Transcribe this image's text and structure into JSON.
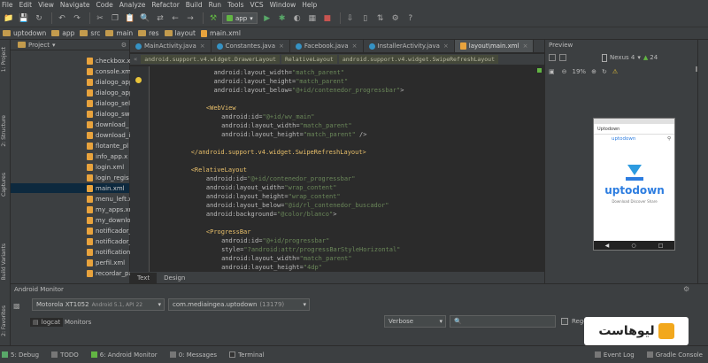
{
  "menu": [
    "File",
    "Edit",
    "View",
    "Navigate",
    "Code",
    "Analyze",
    "Refactor",
    "Build",
    "Run",
    "Tools",
    "VCS",
    "Window",
    "Help"
  ],
  "toolbar": {
    "run_config": "app"
  },
  "nav": [
    "uptodown",
    "app",
    "src",
    "main",
    "res",
    "layout",
    "main.xml"
  ],
  "left_tools": [
    "1: Project",
    "2: Structure",
    "Captures",
    "Build Variants",
    "2: Favorites"
  ],
  "project": {
    "header": "Project",
    "files": [
      "checkbox.xr",
      "console.xml",
      "dialogo_app",
      "dialogo_app",
      "dialogo_sel",
      "dialogo_sw",
      "download_",
      "download_i",
      "flotante_pl",
      "info_app.x",
      "login.xml",
      "login_regis",
      "main.xml",
      "menu_left.x",
      "my_apps.xm",
      "my_downlo",
      "notificador_",
      "notificador_",
      "notification",
      "perfil.xml",
      "recordar_pa"
    ]
  },
  "tabs": [
    "MainActivity.java",
    "Constantes.java",
    "Facebook.java",
    "InstallerActivity.java",
    "layout\\main.xml"
  ],
  "breadcrumbs": [
    "android.support.v4.widget.DrawerLayout",
    "RelativeLayout",
    "android.support.v4.widget.SwipeRefreshLayout"
  ],
  "code": [
    {
      "t": "android:layout_width=\"match_parent\"",
      "c": "attr",
      "i": 15
    },
    {
      "t": "android:layout_height=\"match_parent\"",
      "c": "attr",
      "i": 15
    },
    {
      "t": "android:layout_below=\"@+id/contenedor_progressbar\">",
      "c": "attr",
      "i": 15
    },
    {
      "t": "",
      "c": "attr",
      "i": 0
    },
    {
      "t": "<WebView",
      "c": "tag",
      "i": 13
    },
    {
      "t": "android:id=\"@+id/wv_main\"",
      "c": "attr",
      "i": 17
    },
    {
      "t": "android:layout_width=\"match_parent\"",
      "c": "attr",
      "i": 17
    },
    {
      "t": "android:layout_height=\"match_parent\" />",
      "c": "attr",
      "i": 17
    },
    {
      "t": "",
      "c": "attr",
      "i": 0
    },
    {
      "t": "</android.support.v4.widget.SwipeRefreshLayout>",
      "c": "tag",
      "i": 9
    },
    {
      "t": "",
      "c": "attr",
      "i": 0
    },
    {
      "t": "<RelativeLayout",
      "c": "tag",
      "i": 9
    },
    {
      "t": "android:id=\"@+id/contenedor_progressbar\"",
      "c": "attr",
      "i": 13
    },
    {
      "t": "android:layout_width=\"wrap_content\"",
      "c": "attr",
      "i": 13
    },
    {
      "t": "android:layout_height=\"wrap_content\"",
      "c": "attr",
      "i": 13
    },
    {
      "t": "android:layout_below=\"@id/rl_contenedor_buscador\"",
      "c": "attr",
      "i": 13
    },
    {
      "t": "android:background=\"@color/blanco\">",
      "c": "attr",
      "i": 13
    },
    {
      "t": "",
      "c": "attr",
      "i": 0
    },
    {
      "t": "<ProgressBar",
      "c": "tag",
      "i": 13
    },
    {
      "t": "android:id=\"@+id/progressbar\"",
      "c": "attr",
      "i": 17
    },
    {
      "t": "style=\"?android:attr/progressBarStyleHorizontal\"",
      "c": "attr",
      "i": 17
    },
    {
      "t": "android:layout_width=\"match_parent\"",
      "c": "attr",
      "i": 17
    },
    {
      "t": "android:layout_height=\"4dp\"",
      "c": "attr",
      "i": 17
    }
  ],
  "design_tabs": [
    "Text",
    "Design"
  ],
  "preview": {
    "title": "Preview",
    "device": "Nexus 4",
    "api": "24",
    "zoom": "19%",
    "status_app": "Uptodown",
    "app_header": "uptodown",
    "logo": "uptodown",
    "tagline": "Download Discover Share"
  },
  "monitor": {
    "title": "Android Monitor",
    "device": "Motorola XT1052",
    "device_sub": "Android 5.1, API 22",
    "process": "com.mediaingea.uptodown",
    "pid": "(13179)",
    "logcat": "logcat",
    "monitors": "Monitors",
    "level": "Verbose",
    "regex": "Regex"
  },
  "bottom": [
    "5: Debug",
    "TODO",
    "6: Android Monitor",
    "0: Messages",
    "Terminal",
    "Event Log",
    "Gradle Console"
  ],
  "watermark": "لیوهاست"
}
